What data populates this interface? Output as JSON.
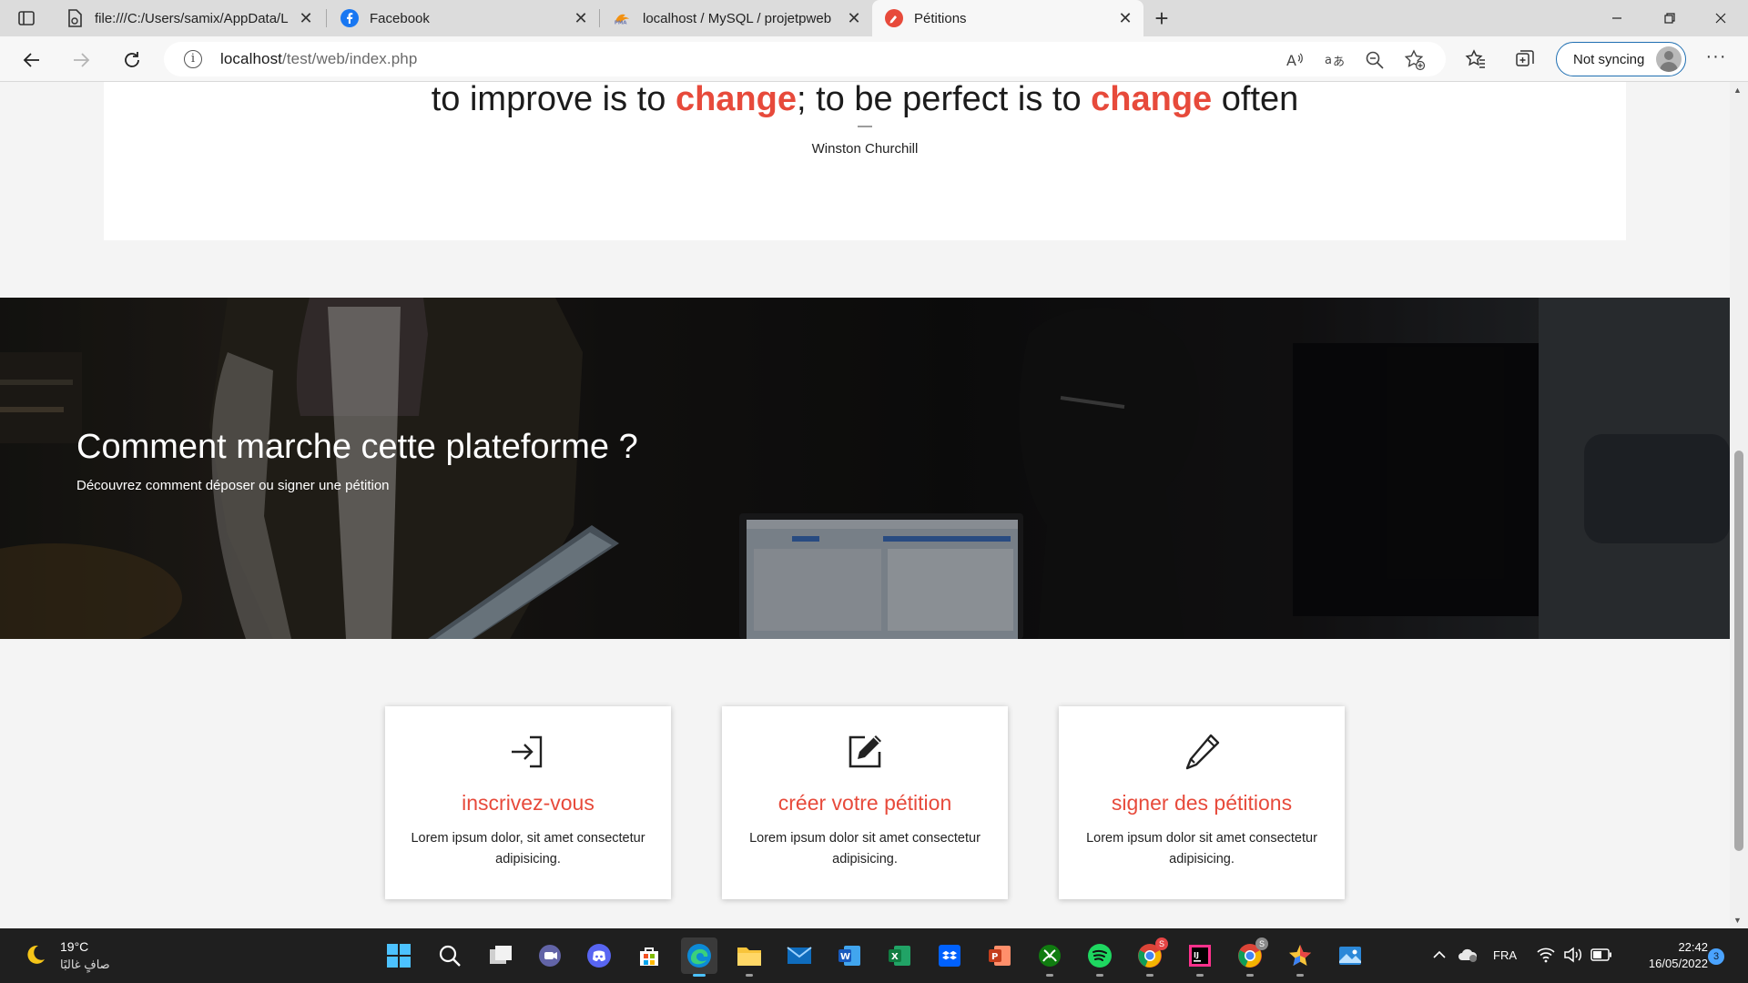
{
  "browser": {
    "tabs": [
      {
        "title": "file:///C:/Users/samix/AppData/L",
        "icon": "file-icon",
        "active": false
      },
      {
        "title": "Facebook",
        "icon": "facebook-icon",
        "active": false
      },
      {
        "title": "localhost / MySQL / projetpweb",
        "icon": "phpmyadmin-icon",
        "active": false
      },
      {
        "title": "Pétitions",
        "icon": "petitions-icon",
        "active": true
      }
    ],
    "close_glyph": "✕",
    "new_tab_glyph": "+",
    "url_host": "localhost",
    "url_path": "/test/web/index.php",
    "profile_label": "Not syncing",
    "more_glyph": "···"
  },
  "page": {
    "quote": {
      "part1": "to improve is to ",
      "highlight1": "change",
      "part2": "; to be perfect is to ",
      "highlight2": "change",
      "part3": " often",
      "dash": "—",
      "author": "Winston Churchill"
    },
    "hero": {
      "title": "Comment marche cette plateforme ?",
      "subtitle": "Découvrez comment déposer ou signer une pétition"
    },
    "cards": [
      {
        "icon": "sign-in-icon",
        "title": "inscrivez-vous",
        "text": "Lorem ipsum dolor, sit amet consectetur adipisicing."
      },
      {
        "icon": "edit-icon",
        "title": "créer votre pétition",
        "text": "Lorem ipsum dolor sit amet consectetur adipisicing."
      },
      {
        "icon": "pencil-icon",
        "title": "signer des pétitions",
        "text": "Lorem ipsum dolor sit amet consectetur adipisicing."
      }
    ],
    "accent_color": "#e74a3b"
  },
  "taskbar": {
    "weather_temp": "19°C",
    "weather_desc": "صافٍ غالبًا",
    "language": "FRA",
    "time": "22:42",
    "date": "16/05/2022",
    "notification_count": "3",
    "app_badges": {
      "chrome_1": "S",
      "chrome_2": "S"
    }
  }
}
